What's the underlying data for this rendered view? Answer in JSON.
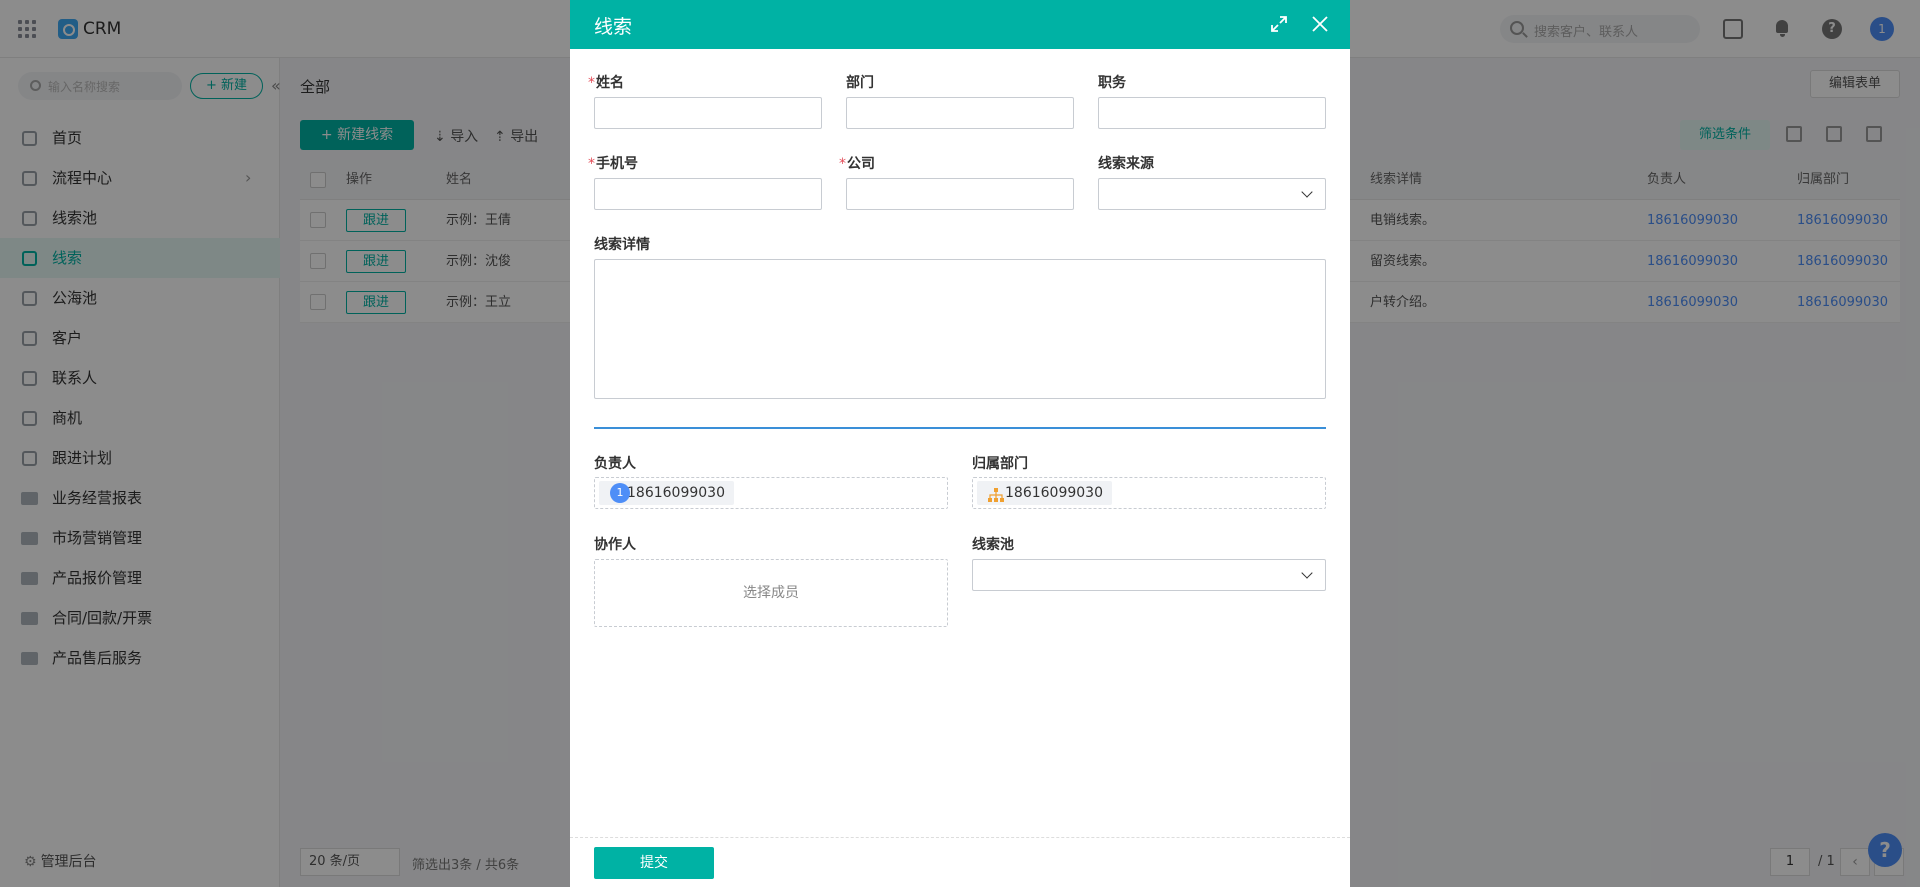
{
  "app": {
    "title": "CRM",
    "search_placeholder": "搜索客户、联系人",
    "user_initial": "1"
  },
  "sidebar": {
    "search_placeholder": "输入名称搜索",
    "new_label": "+ 新建",
    "items": [
      {
        "label": "首页",
        "icon": "home-icon"
      },
      {
        "label": "流程中心",
        "icon": "flow-icon"
      },
      {
        "label": "线索池",
        "icon": "pool-icon"
      },
      {
        "label": "线索",
        "icon": "lead-icon",
        "active": true
      },
      {
        "label": "公海池",
        "icon": "sea-icon"
      },
      {
        "label": "客户",
        "icon": "customer-icon"
      },
      {
        "label": "联系人",
        "icon": "contact-icon"
      },
      {
        "label": "商机",
        "icon": "opportunity-icon"
      },
      {
        "label": "跟进计划",
        "icon": "plan-icon"
      },
      {
        "label": "业务经营报表",
        "icon": "folder-icon"
      },
      {
        "label": "市场营销管理",
        "icon": "folder-icon"
      },
      {
        "label": "产品报价管理",
        "icon": "folder-icon"
      },
      {
        "label": "合同/回款/开票",
        "icon": "folder-icon"
      },
      {
        "label": "产品售后服务",
        "icon": "folder-icon"
      }
    ],
    "admin_label": "管理后台"
  },
  "main": {
    "breadcrumb": "全部",
    "edit_form": "编辑表单",
    "new_lead": "+ 新建线索",
    "import": "导入",
    "export": "导出",
    "filter": "筛选条件",
    "columns": [
      "操作",
      "姓名",
      "线索详情",
      "负责人",
      "归属部门"
    ],
    "rows": [
      {
        "action": "跟进",
        "name": "示例：王倩",
        "detail": "电销线索。",
        "owner": "18616099030",
        "dept": "18616099030"
      },
      {
        "action": "跟进",
        "name": "示例：沈俊",
        "detail": "留资线索。",
        "owner": "18616099030",
        "dept": "18616099030"
      },
      {
        "action": "跟进",
        "name": "示例：王立",
        "detail": "户转介绍。",
        "owner": "18616099030",
        "dept": "18616099030"
      }
    ],
    "page_size": "20 条/页",
    "filter_info": "筛选出3条 / 共6条",
    "page_current": "1",
    "page_total": "/ 1"
  },
  "modal": {
    "title": "线索",
    "fields": {
      "name_label": "姓名",
      "dept_label": "部门",
      "title_label": "职务",
      "phone_label": "手机号",
      "company_label": "公司",
      "source_label": "线索来源",
      "detail_label": "线索详情",
      "owner_label": "负责人",
      "owner_value": "18616099030",
      "owner_initial": "1",
      "belong_dept_label": "归属部门",
      "belong_dept_value": "18616099030",
      "collab_label": "协作人",
      "collab_placeholder": "选择成员",
      "pool_label": "线索池"
    },
    "required_mark": "*",
    "submit": "提交"
  },
  "colors": {
    "accent": "#00b2a4",
    "link": "#4e8ef7",
    "required": "#e34d59",
    "divider": "#3a8fd8"
  }
}
